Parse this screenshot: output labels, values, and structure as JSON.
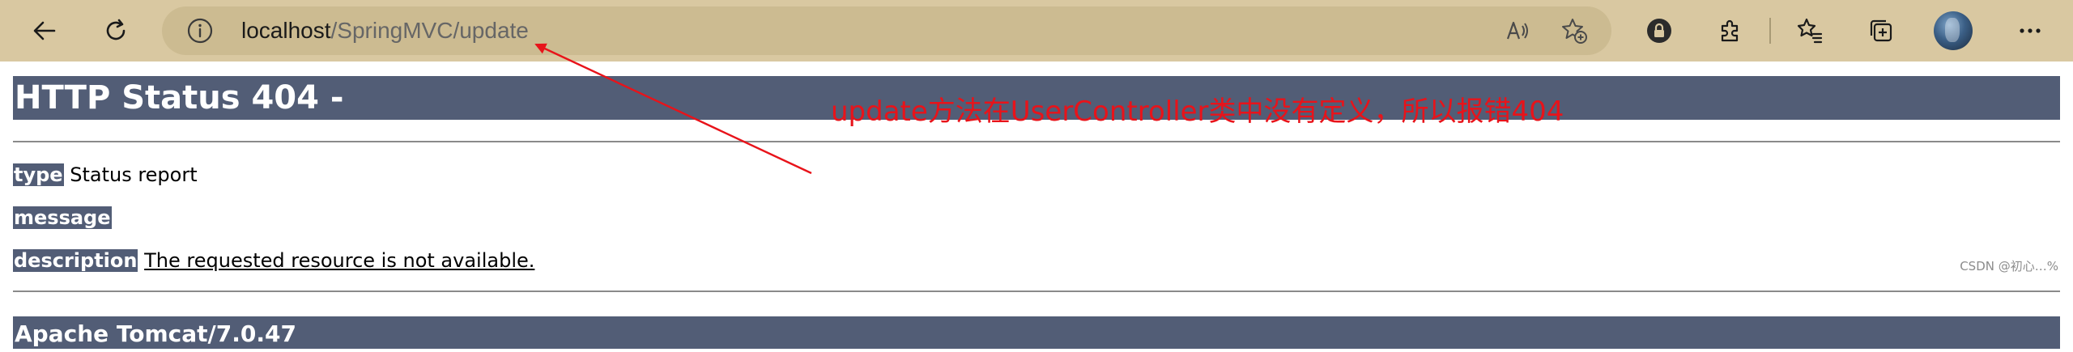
{
  "browser": {
    "url_host": "localhost",
    "url_path": "/SpringMVC/update",
    "icons": [
      "back-icon",
      "refresh-icon",
      "info-icon",
      "read-aloud-icon",
      "add-favorite-icon",
      "extension-lock-icon",
      "extensions-icon",
      "favorites-icon",
      "collections-icon",
      "avatar",
      "more-icon"
    ]
  },
  "page": {
    "heading": "HTTP Status 404 -",
    "type_label": "type",
    "type_value": "Status report",
    "message_label": "message",
    "message_value": "",
    "description_label": "description",
    "description_value": "The requested resource is not available.",
    "footer": "Apache Tomcat/7.0.47"
  },
  "annotation": {
    "text": "update方法在UserController类中没有定义，所以报错404",
    "color": "#e8131a"
  },
  "watermark": "CSDN @初心…%",
  "colors": {
    "toolbar_bg": "#d9c8a1",
    "address_bg": "#ccbb91",
    "tomcat_bar": "#525d76",
    "annotation_red": "#e8131a"
  }
}
